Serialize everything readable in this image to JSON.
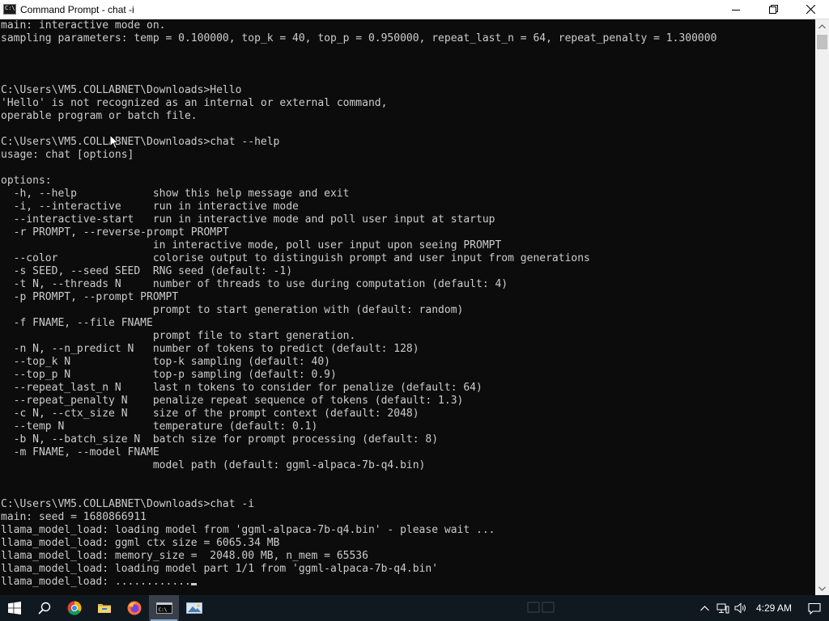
{
  "window": {
    "title": "Command Prompt - chat  -i",
    "icon_label": "C:\\"
  },
  "console": {
    "lines": [
      "main: interactive mode on.",
      "sampling parameters: temp = 0.100000, top_k = 40, top_p = 0.950000, repeat_last_n = 64, repeat_penalty = 1.300000",
      "",
      "",
      "",
      "C:\\Users\\VM5.COLLABNET\\Downloads>Hello",
      "'Hello' is not recognized as an internal or external command,",
      "operable program or batch file.",
      "",
      "C:\\Users\\VM5.COLLABNET\\Downloads>chat --help",
      "usage: chat [options]",
      "",
      "options:",
      "  -h, --help            show this help message and exit",
      "  -i, --interactive     run in interactive mode",
      "  --interactive-start   run in interactive mode and poll user input at startup",
      "  -r PROMPT, --reverse-prompt PROMPT",
      "                        in interactive mode, poll user input upon seeing PROMPT",
      "  --color               colorise output to distinguish prompt and user input from generations",
      "  -s SEED, --seed SEED  RNG seed (default: -1)",
      "  -t N, --threads N     number of threads to use during computation (default: 4)",
      "  -p PROMPT, --prompt PROMPT",
      "                        prompt to start generation with (default: random)",
      "  -f FNAME, --file FNAME",
      "                        prompt file to start generation.",
      "  -n N, --n_predict N   number of tokens to predict (default: 128)",
      "  --top_k N             top-k sampling (default: 40)",
      "  --top_p N             top-p sampling (default: 0.9)",
      "  --repeat_last_n N     last n tokens to consider for penalize (default: 64)",
      "  --repeat_penalty N    penalize repeat sequence of tokens (default: 1.3)",
      "  -c N, --ctx_size N    size of the prompt context (default: 2048)",
      "  --temp N              temperature (default: 0.1)",
      "  -b N, --batch_size N  batch size for prompt processing (default: 8)",
      "  -m FNAME, --model FNAME",
      "                        model path (default: ggml-alpaca-7b-q4.bin)",
      "",
      "",
      "C:\\Users\\VM5.COLLABNET\\Downloads>chat -i",
      "main: seed = 1680866911",
      "llama_model_load: loading model from 'ggml-alpaca-7b-q4.bin' - please wait ...",
      "llama_model_load: ggml ctx size = 6065.34 MB",
      "llama_model_load: memory_size =  2048.00 MB, n_mem = 65536",
      "llama_model_load: loading model part 1/1 from 'ggml-alpaca-7b-q4.bin'",
      "llama_model_load: ............"
    ]
  },
  "taskbar": {
    "apps": [
      {
        "name": "start",
        "icon": "windows-logo-icon"
      },
      {
        "name": "search",
        "icon": "search-icon"
      },
      {
        "name": "chrome",
        "icon": "chrome-icon"
      },
      {
        "name": "file-explorer",
        "icon": "folder-icon"
      },
      {
        "name": "firefox",
        "icon": "firefox-icon"
      },
      {
        "name": "command-prompt",
        "icon": "cmd-icon",
        "active": true
      },
      {
        "name": "photos",
        "icon": "image-viewer-icon"
      }
    ],
    "time": "4:29 AM"
  },
  "colors": {
    "console_bg": "#0c0c0c",
    "console_text": "#cccccc",
    "taskbar_bg": "#101820"
  }
}
